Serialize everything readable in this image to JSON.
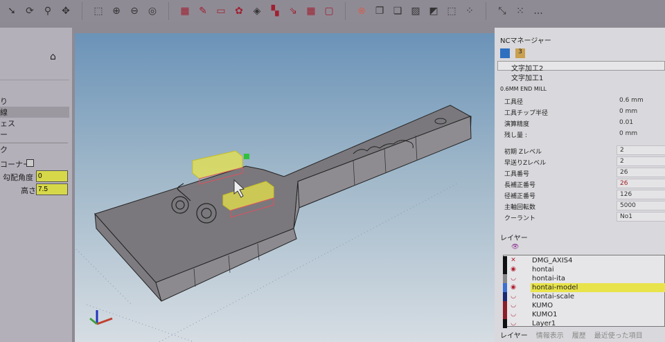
{
  "toolbar": {
    "icons": [
      "select-arrow-icon",
      "rotate-icon",
      "zoom-icon",
      "pan-icon",
      "zoom-window-icon",
      "zoom-in-icon",
      "zoom-out-icon",
      "zoom-fit-icon",
      "grid-view-icon",
      "pen-icon",
      "dual-view-icon",
      "palette-icon",
      "layers-stack-icon",
      "grid-color-icon",
      "swap-icon",
      "grid4-icon",
      "grid-empty-icon",
      "cancel-icon",
      "overlap1-icon",
      "overlap2-icon",
      "hatch-icon",
      "hatch2-icon",
      "box-dotted-icon",
      "points-icon",
      "measure-icon",
      "points2-icon"
    ],
    "more": "..."
  },
  "left": {
    "items": [
      "り",
      "線",
      "ェス",
      "ー",
      "ク"
    ],
    "corner_label": "コーナー",
    "slope_label": "勾配角度",
    "slope_value": "0",
    "height_label": "高さ",
    "height_value": "7.5"
  },
  "right": {
    "title": "NCマネージャー",
    "operations": [
      "文字加工2",
      "文字加工1"
    ],
    "tool_name": "0.6MM END MILL",
    "tool_params": [
      {
        "label": "工具径",
        "value": "0.6 mm"
      },
      {
        "label": "工具チップ半径",
        "value": "0 mm"
      },
      {
        "label": "演算精度",
        "value": "0.01"
      },
      {
        "label": "残し量 :",
        "value": "0 mm"
      }
    ],
    "nc_params": [
      {
        "label": "初期 Zレベル",
        "value": "2"
      },
      {
        "label": "早送りZレベル",
        "value": "2"
      },
      {
        "label": "工具番号",
        "value": "26"
      },
      {
        "label": "長補正番号",
        "value": "26"
      },
      {
        "label": "径補正番号",
        "value": "126"
      },
      {
        "label": "主軸回転数",
        "value": "5000"
      },
      {
        "label": "クーラント",
        "value": "No1"
      }
    ],
    "layers_title": "レイヤー",
    "layers": [
      {
        "name": "DMG_AXIS4",
        "visible": false,
        "color": "#111111"
      },
      {
        "name": "hontai",
        "visible": true,
        "color": "#111111"
      },
      {
        "name": "hontai-ita",
        "visible": false,
        "color": "#888888"
      },
      {
        "name": "hontai-model",
        "visible": true,
        "selected": true,
        "color": "#3b6fd0"
      },
      {
        "name": "hontai-scale",
        "visible": false,
        "color": "#1a2a70"
      },
      {
        "name": "KUMO",
        "visible": false,
        "color": "#8a1f2a"
      },
      {
        "name": "KUMO1",
        "visible": false,
        "color": "#8a1f2a"
      },
      {
        "name": "Layer1",
        "visible": false,
        "color": "#111111"
      }
    ],
    "bottom_tabs": [
      "レイヤー",
      "情報表示",
      "履歴",
      "最近使った項目"
    ]
  },
  "colors": {
    "highlight": "#e8e34a",
    "selection": "#d8dc3a",
    "toolpath": "#e05060"
  }
}
